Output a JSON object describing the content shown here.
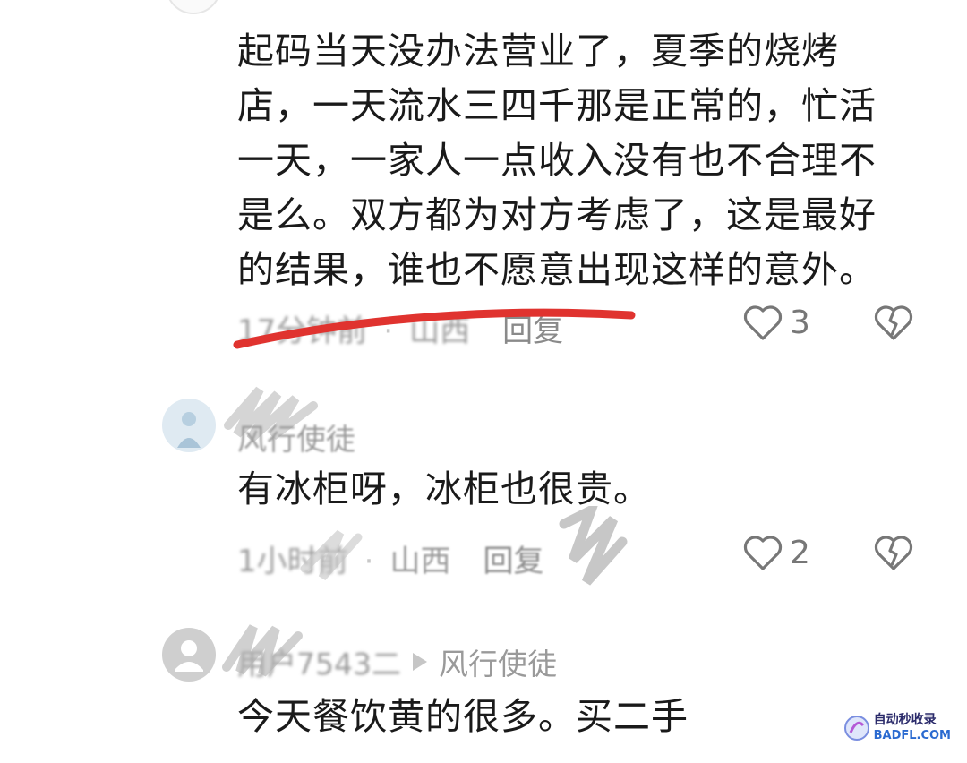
{
  "comments": [
    {
      "text_lines": [
        "起码当天没办法营业了，夏季的烧烤",
        "店，一天流水三四千那是正常的，忙活",
        "一天，一家人一点收入没有也不合理不",
        "是么。双方都为对方考虑了，这是最好",
        "的结果，谁也不愿意出现这样的意外。"
      ],
      "time": "17分钟前",
      "location": "山西",
      "reply_label": "回复",
      "likes": "3"
    },
    {
      "username": "风行使徒",
      "text_lines": [
        "有冰柜呀，冰柜也很贵。"
      ],
      "time": "1小时前",
      "location": "山西",
      "reply_label": "回复",
      "likes": "2"
    },
    {
      "username": "用户7543二",
      "reply_to": "风行使徒",
      "text_lines": [
        "今天餐饮黄的很多。买二手"
      ]
    }
  ],
  "icons": {
    "like": "heart-outline-icon",
    "dislike": "broken-heart-icon",
    "reply_arrow": "triangle-right-icon"
  },
  "colors": {
    "annotation_underline": "#e0332f",
    "text": "#1a1a1a",
    "meta": "#9a9a9a"
  },
  "watermark": {
    "cn": "自动秒收录",
    "en": "BADFL.COM"
  }
}
